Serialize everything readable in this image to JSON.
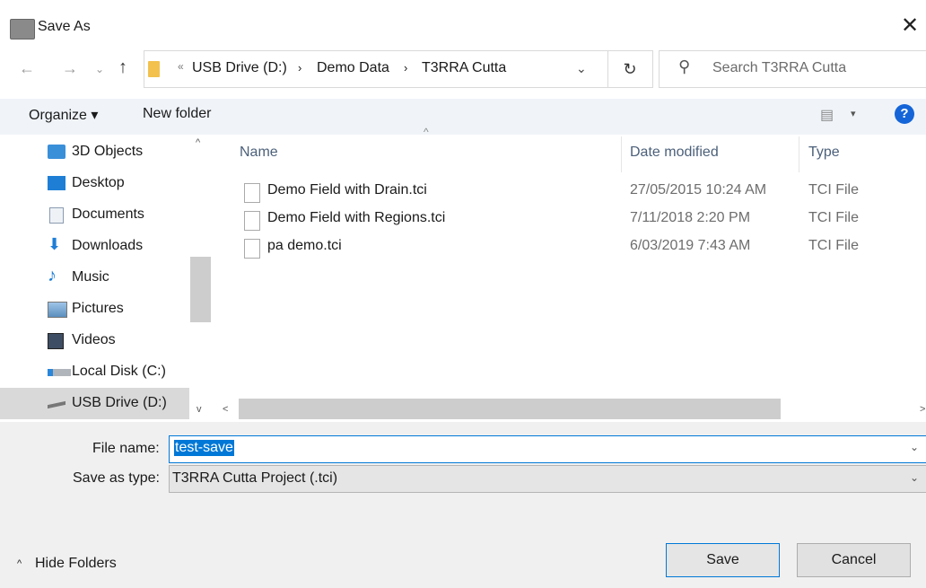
{
  "window": {
    "title": "Save As",
    "close_glyph": "✕"
  },
  "nav": {
    "back_glyph": "←",
    "forward_glyph": "→",
    "recent_glyph": "⌄",
    "up_glyph": "↑",
    "overflow_glyph": "«",
    "breadcrumbs": [
      "USB Drive (D:)",
      "Demo Data",
      "T3RRA Cutta"
    ],
    "separator": "›",
    "dropdown_glyph": "⌄",
    "refresh_glyph": "↻",
    "search_placeholder": "Search T3RRA Cutta"
  },
  "toolbar": {
    "organize": "Organize ▾",
    "new_folder": "New folder",
    "view_glyph": "▤",
    "view_drop": "▾",
    "help": "?"
  },
  "sidebar": {
    "items": [
      {
        "label": "3D Objects",
        "icon": "3d-objects-icon"
      },
      {
        "label": "Desktop",
        "icon": "desktop-icon"
      },
      {
        "label": "Documents",
        "icon": "documents-icon"
      },
      {
        "label": "Downloads",
        "icon": "downloads-icon"
      },
      {
        "label": "Music",
        "icon": "music-icon"
      },
      {
        "label": "Pictures",
        "icon": "pictures-icon"
      },
      {
        "label": "Videos",
        "icon": "videos-icon"
      },
      {
        "label": "Local Disk (C:)",
        "icon": "local-disk-icon"
      },
      {
        "label": "USB Drive (D:)",
        "icon": "usb-drive-icon",
        "selected": true
      }
    ]
  },
  "file_list": {
    "columns": {
      "name": "Name",
      "date": "Date modified",
      "type": "Type"
    },
    "sort_glyph": "^",
    "rows": [
      {
        "name": "Demo Field with Drain.tci",
        "date": "27/05/2015 10:24 AM",
        "type": "TCI File"
      },
      {
        "name": "Demo Field with Regions.tci",
        "date": "7/11/2018 2:20 PM",
        "type": "TCI File"
      },
      {
        "name": "pa demo.tci",
        "date": "6/03/2019 7:43 AM",
        "type": "TCI File"
      }
    ]
  },
  "scroll": {
    "up": "^",
    "down": "v",
    "left": "<",
    "right": ">"
  },
  "form": {
    "filename_label": "File name:",
    "filename_value": "test-save",
    "type_label": "Save as type:",
    "type_value": "T3RRA Cutta Project (.tci)",
    "drop_glyph": "⌄"
  },
  "footer": {
    "hide_folders": "Hide Folders",
    "hide_glyph": "^",
    "save": "Save",
    "cancel": "Cancel"
  },
  "colors": {
    "accent": "#0078d7",
    "help": "#1565d8",
    "selected": "#d9d9d9"
  }
}
